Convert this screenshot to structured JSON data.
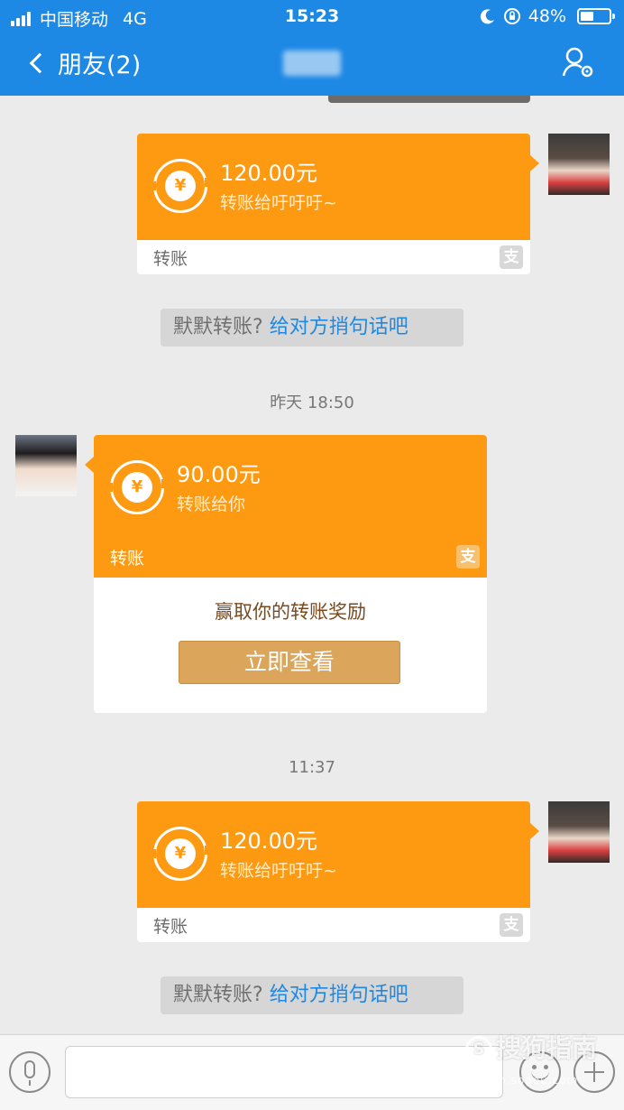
{
  "status_bar": {
    "carrier": "中国移动",
    "network": "4G",
    "time": "15:23",
    "battery": "48%",
    "battery_level": 0.48
  },
  "nav": {
    "back_label": "朋友(2)"
  },
  "messages": [
    {
      "amount": "120.00元",
      "description": "转账给吁吁吁~",
      "footer": "转账",
      "alipay_glyph": "支"
    },
    {
      "amount": "90.00元",
      "description": "转账给你",
      "footer": "转账",
      "alipay_glyph": "支",
      "promo_text": "赢取你的转账奖励",
      "promo_button": "立即查看"
    },
    {
      "amount": "120.00元",
      "description": "转账给吁吁吁~",
      "footer": "转账",
      "alipay_glyph": "支"
    }
  ],
  "tips": [
    {
      "prefix": "默默转账?",
      "action": "给对方捎句话吧"
    },
    {
      "prefix": "默默转账?",
      "action": "给对方捎句话吧"
    }
  ],
  "timestamps": [
    "昨天 18:50",
    "11:37"
  ],
  "watermark": {
    "text": "搜狗指南",
    "sub": "zhinan.sogou.com",
    "logo": "S"
  },
  "coin_glyph": "¥",
  "colors": {
    "header_blue": "#1e88e5",
    "transfer_orange": "#fe9a12",
    "promo_button": "#dba55c",
    "link_blue": "#1e88e5"
  },
  "icons": [
    "signal-icon",
    "moon-icon",
    "rotation-lock-icon",
    "battery-icon",
    "back-chevron-icon",
    "contact-settings-icon",
    "transfer-coin-icon",
    "alipay-icon",
    "microphone-icon",
    "emoji-icon",
    "plus-icon"
  ]
}
